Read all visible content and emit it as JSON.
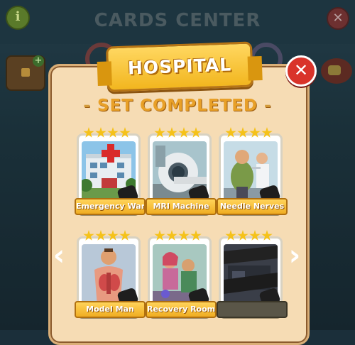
{
  "header": {
    "title": "CARDS CENTER",
    "info_icon": "i",
    "close_icon": "✕"
  },
  "popup": {
    "banner": "HOSPITAL",
    "subtitle": "SET COMPLETED",
    "subtitle_dashes": [
      "-",
      "-"
    ],
    "close_icon": "✕",
    "nav_prev": "‹",
    "nav_next": "›"
  },
  "cards": [
    {
      "name": "Emergency Ward",
      "stars": 4
    },
    {
      "name": "MRI Machine",
      "stars": 4
    },
    {
      "name": "Needle Nerves",
      "stars": 4
    },
    {
      "name": "Model Man",
      "stars": 4
    },
    {
      "name": "Recovery Room",
      "stars": 4
    },
    {
      "name": "",
      "stars": 4,
      "obscured": true
    }
  ],
  "colors": {
    "banner": "#f2b61f",
    "panel": "#f6dcb4",
    "close": "#d9332a",
    "star": "#f5c21a",
    "subtitle": "#e8a028"
  }
}
